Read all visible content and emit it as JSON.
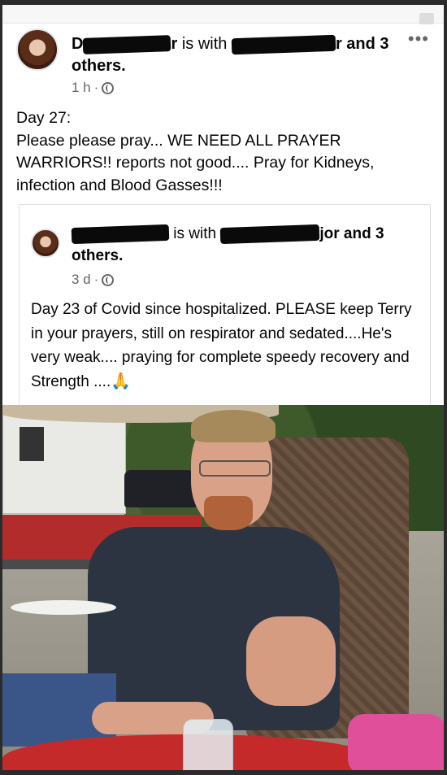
{
  "post": {
    "author_visible": "D",
    "author_tail": "r",
    "with_text": "is with",
    "tagged_tail": "r and 3",
    "others": "others.",
    "time": "1 h",
    "dot": "·",
    "more": "•••",
    "body": "Day 27:\nPlease please pray... WE NEED ALL PRAYER WARRIORS!! reports not good.... Pray for Kidneys, infection and Blood Gasses!!!"
  },
  "shared_post": {
    "with_text": "is with",
    "tagged_tail": "jor and 3",
    "others": "others.",
    "time": "3 d",
    "dot": "·",
    "body": "Day 23 of Covid since hospitalized. PLEASE keep Terry in your prayers, still on respirator and sedated....He's very weak.... praying for complete speedy recovery and Strength ....",
    "emoji": "🙏"
  },
  "icons": {
    "globe": "globe-icon",
    "more": "more-options-icon",
    "avatar": "profile-photo"
  }
}
